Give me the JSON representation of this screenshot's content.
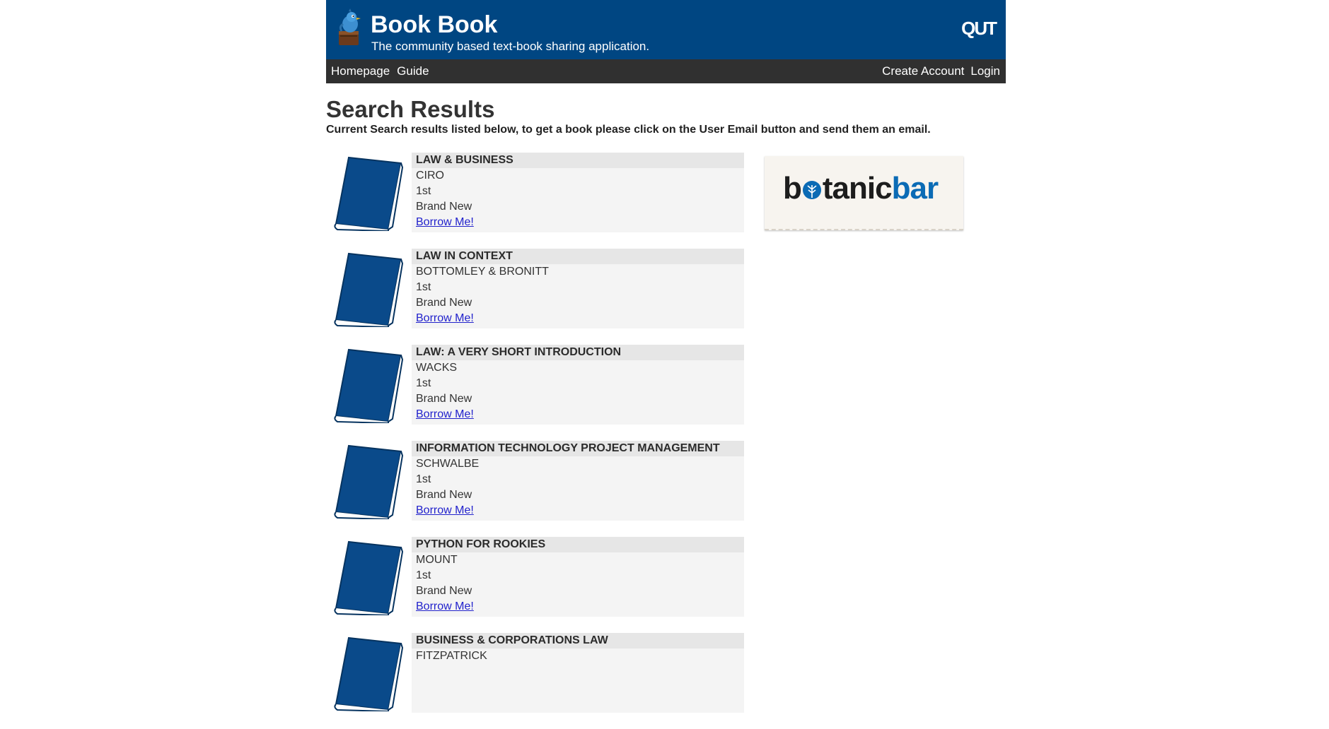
{
  "header": {
    "title": "Book Book",
    "tagline": "The community based text-book sharing application.",
    "logo_text": "QUT"
  },
  "nav": {
    "left": [
      {
        "label": "Homepage"
      },
      {
        "label": "Guide"
      }
    ],
    "right": [
      {
        "label": "Create Account"
      },
      {
        "label": "Login"
      }
    ]
  },
  "page": {
    "title": "Search Results",
    "subtitle": "Current Search results listed below, to get a book please click on the User Email button and send them an email."
  },
  "results": [
    {
      "title": "LAW & BUSINESS",
      "author": "CIRO",
      "edition": "1st",
      "condition": "Brand New",
      "action": "Borrow Me!"
    },
    {
      "title": "LAW IN CONTEXT",
      "author": "BOTTOMLEY & BRONITT",
      "edition": "1st",
      "condition": "Brand New",
      "action": "Borrow Me!"
    },
    {
      "title": "LAW: A VERY SHORT INTRODUCTION",
      "author": "WACKS",
      "edition": "1st",
      "condition": "Brand New",
      "action": "Borrow Me!"
    },
    {
      "title": "INFORMATION TECHNOLOGY PROJECT MANAGEMENT",
      "author": "SCHWALBE",
      "edition": "1st",
      "condition": "Brand New",
      "action": "Borrow Me!"
    },
    {
      "title": "PYTHON FOR ROOKIES",
      "author": "MOUNT",
      "edition": "1st",
      "condition": "Brand New",
      "action": "Borrow Me!"
    },
    {
      "title": "BUSINESS & CORPORATIONS LAW",
      "author": "FITZPATRICK",
      "edition": "",
      "condition": "",
      "action": ""
    }
  ],
  "ad": {
    "text_dark_1": "b",
    "text_dark_2": "tanic",
    "text_blue": "bar"
  },
  "colors": {
    "header_bg": "#004682",
    "nav_bg": "#303030",
    "book_blue": "#0a4a8a",
    "link": "#2222cc"
  }
}
